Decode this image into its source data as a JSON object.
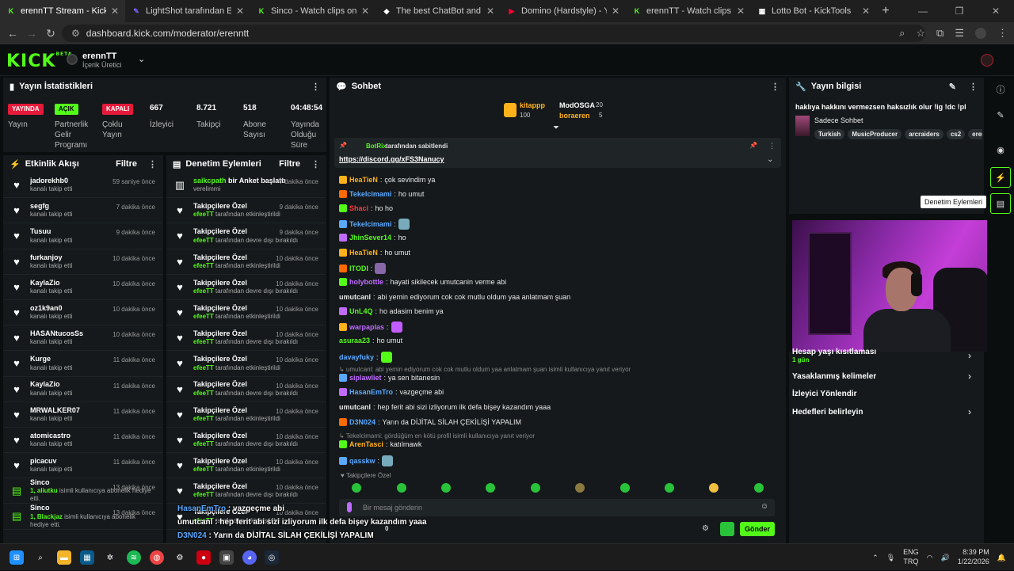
{
  "browser": {
    "tabs": [
      {
        "title": "erennTT Stream - Kick Dashboar",
        "color": "#53fc18",
        "glyph": "K"
      },
      {
        "title": "LightShot tarafından Ekran Gör",
        "color": "#7b5cff",
        "glyph": "✎"
      },
      {
        "title": "Sinco - Watch clips on Kick",
        "color": "#53fc18",
        "glyph": "K"
      },
      {
        "title": "The best ChatBot and Widgets",
        "color": "#ffffff",
        "glyph": "◆"
      },
      {
        "title": "Domino (Hardstyle) - YouTube",
        "color": "#ff0033",
        "glyph": "▶"
      },
      {
        "title": "erennTT - Watch clips on Kick",
        "color": "#53fc18",
        "glyph": "K"
      },
      {
        "title": "Lotto Bot - KickTools",
        "color": "#ffffff",
        "glyph": "▦"
      }
    ],
    "url": "dashboard.kick.com/moderator/erenntt"
  },
  "header": {
    "logo": "KICK",
    "logo_sup": "BETA",
    "channel_name": "erennTT",
    "channel_role": "İçerik Üretici"
  },
  "stats": {
    "title": "Yayın İstatistikleri",
    "items": [
      {
        "pill": "YAYINDA",
        "label": "Yayın"
      },
      {
        "pill": "AÇIK",
        "label": "Partnerlik Gelir Programı"
      },
      {
        "pill": "KAPALI",
        "label": "Çoklu Yayın"
      },
      {
        "value": "667",
        "label": "İzleyici"
      },
      {
        "value": "8.721",
        "label": "Takipçi"
      },
      {
        "value": "518",
        "label": "Abone Sayısı"
      },
      {
        "value": "04:48:54",
        "label": "Yayında Olduğu Süre"
      }
    ]
  },
  "activity": {
    "title": "Etkinlik Akışı",
    "filter": "Filtre",
    "rows": [
      {
        "name": "jadorekhb0",
        "sub": "kanalı takip etti",
        "time": "59 saniye önce"
      },
      {
        "name": "segfg",
        "sub": "kanalı takip etti",
        "time": "7 dakika önce"
      },
      {
        "name": "Tusuu",
        "sub": "kanalı takip etti",
        "time": "9 dakika önce"
      },
      {
        "name": "furkanjoy",
        "sub": "kanalı takip etti",
        "time": "10 dakika önce"
      },
      {
        "name": "KaylaZio",
        "sub": "kanalı takip etti",
        "time": "10 dakika önce"
      },
      {
        "name": "oz1k9an0",
        "sub": "kanalı takip etti",
        "time": "10 dakika önce"
      },
      {
        "name": "HASANtucosSs",
        "sub": "kanalı takip etti",
        "time": "10 dakika önce"
      },
      {
        "name": "Kurge",
        "sub": "kanalı takip etti",
        "time": "11 dakika önce"
      },
      {
        "name": "KaylaZio",
        "sub": "kanalı takip etti",
        "time": "11 dakika önce"
      },
      {
        "name": "MRWALKER07",
        "sub": "kanalı takip etti",
        "time": "11 dakika önce"
      },
      {
        "name": "atomicastro",
        "sub": "kanalı takip etti",
        "time": "11 dakika önce"
      },
      {
        "name": "picacuv",
        "sub": "kanalı takip etti",
        "time": "11 dakika önce"
      },
      {
        "name": "Sinco",
        "sub_bold": "1, aliutku",
        "sub": "isimli kullanıcıya abonelik hediye etti.",
        "time": "13 dakika önce"
      },
      {
        "name": "Sinco",
        "sub_bold": "1, Blackjaz",
        "sub": "isimli kullanıcıya abonelik hediye etti.",
        "time": "13 dakika önce"
      }
    ]
  },
  "modlog": {
    "title": "Denetim Eylemleri",
    "filter": "Filtre",
    "rows": [
      {
        "name_green": "saikcpath",
        "name": "bir Anket başlattı",
        "sub": "verelimmi",
        "time": "7 dakika önce"
      },
      {
        "name": "Takipçilere Özel",
        "sub_bold": "efeeTT",
        "sub": "tarafından etkinleştirildi",
        "time": "9 dakika önce"
      },
      {
        "name": "Takipçilere Özel",
        "sub_bold": "efeeTT",
        "sub": "tarafından devre dışı bırakıldı",
        "time": "9 dakika önce"
      },
      {
        "name": "Takipçilere Özel",
        "sub_bold": "efeeTT",
        "sub": "tarafından etkinleştirildi",
        "time": "10 dakika önce"
      },
      {
        "name": "Takipçilere Özel",
        "sub_bold": "efeeTT",
        "sub": "tarafından devre dışı bırakıldı",
        "time": "10 dakika önce"
      },
      {
        "name": "Takipçilere Özel",
        "sub_bold": "efeeTT",
        "sub": "tarafından etkinleştirildi",
        "time": "10 dakika önce"
      },
      {
        "name": "Takipçilere Özel",
        "sub_bold": "efeeTT",
        "sub": "tarafından devre dışı bırakıldı",
        "time": "10 dakika önce"
      },
      {
        "name": "Takipçilere Özel",
        "sub_bold": "efeeTT",
        "sub": "tarafından etkinleştirildi",
        "time": "10 dakika önce"
      },
      {
        "name": "Takipçilere Özel",
        "sub_bold": "efeeTT",
        "sub": "tarafından devre dışı bırakıldı",
        "time": "10 dakika önce"
      },
      {
        "name": "Takipçilere Özel",
        "sub_bold": "efeeTT",
        "sub": "tarafından etkinleştirildi",
        "time": "10 dakika önce"
      },
      {
        "name": "Takipçilere Özel",
        "sub_bold": "efeeTT",
        "sub": "tarafından devre dışı bırakıldı",
        "time": "10 dakika önce"
      },
      {
        "name": "Takipçilere Özel",
        "sub_bold": "efeeTT",
        "sub": "tarafından etkinleştirildi",
        "time": "10 dakika önce"
      },
      {
        "name": "Takipçilere Özel",
        "sub_bold": "efeeTT",
        "sub": "tarafından devre dışı bırakıldı",
        "time": "10 dakika önce"
      },
      {
        "name": "Takipçilere Özel",
        "sub_bold": "efeeTT",
        "sub": "tarafından etkinleştirildi",
        "time": "10 dakika önce"
      }
    ]
  },
  "chat": {
    "title": "Sohbet",
    "top_users": [
      {
        "name": "kitappp",
        "count": "100",
        "color": "#ffb21b"
      },
      {
        "name": "ModOSGA",
        "count": "20",
        "color": "#ffffff"
      },
      {
        "name": "boraeren",
        "count": "5",
        "color": "#ffb21b"
      }
    ],
    "pinned": {
      "by_user": "BotRix",
      "by_text": "tarafından sabitlendi",
      "link": "https://discord.gg/xFS3Nanucy"
    },
    "messages": [
      {
        "user": "HeaTieN",
        "color": "#ffb21b",
        "text": "çok sevindim ya"
      },
      {
        "user": "Tekelcimami",
        "color": "#5aa9ff",
        "text": "ho umut"
      },
      {
        "user": "Shaci",
        "color": "#ff3a3a",
        "text": "ho ho"
      },
      {
        "user": "Tekelcimami",
        "color": "#5aa9ff",
        "text": ""
      },
      {
        "user": "JhinSever14",
        "color": "#53fc18",
        "text": "ho"
      },
      {
        "user": "HeaTieN",
        "color": "#ffb21b",
        "text": "ho umut"
      },
      {
        "user": "ITODI",
        "color": "#53fc18",
        "text": ""
      },
      {
        "user": "holybottle",
        "color": "#c06bff",
        "text": "hayati sikilecek umutcanin verme abi"
      },
      {
        "user": "umutcanl",
        "color": "#e8e8e8",
        "text": "abi yemin ediyorum cok cok mutlu oldum yaa anlatmam şuan"
      },
      {
        "user": "UnL4Q",
        "color": "#53fc18",
        "text": "ho adasim benim ya"
      },
      {
        "user": "warpaplas",
        "color": "#c06bff",
        "text": ""
      },
      {
        "user": "asuraa23",
        "color": "#53fc18",
        "text": "ho umut"
      },
      {
        "user": "davayfuky",
        "color": "#5aa9ff",
        "text": ""
      },
      {
        "user": "siplawliet",
        "color": "#c06bff",
        "text": "ya sen bitanesin"
      },
      {
        "user": "HasanEmTro",
        "color": "#5aa9ff",
        "text": "vazgeçme abi"
      },
      {
        "user": "umutcanl",
        "color": "#e8e8e8",
        "text": "hep ferit abi sizi izliyorum ilk defa bişey kazandım yaaa"
      },
      {
        "user": "D3N024",
        "color": "#5aa9ff",
        "text": "Yarın da DİJİTAL SİLAH ÇEKİLİŞİ YAPALIM"
      },
      {
        "user": "ArenTasci",
        "color": "#ffb21b",
        "text": "katılmawk"
      },
      {
        "user": "qasskw",
        "color": "#5aa9ff",
        "text": ""
      }
    ],
    "replies": [
      "umutcanl: abi yemin ediyorum cok cok mutlu oldum yaa anlatmam şuan isimli kullanıcıya yanıt veriyor",
      "Tekelcimami: gördüğüm en kötü profil isimli kullanıcıya yanıt veriyor"
    ],
    "mode_note": "Takipçilere Özel",
    "input_placeholder": "Bir mesaj gönderin",
    "send_label": "Gönder"
  },
  "overlay": {
    "lines": [
      {
        "user": "HasanEmTro",
        "text": "vazgeçme abi"
      },
      {
        "user": "umutcanl",
        "text": "hep ferit abi sizi izliyorum ilk defa bişey kazandım yaaa"
      },
      {
        "user": "D3N024",
        "text": "Yarın da DİJİTAL SİLAH ÇEKİLİŞİ YAPALIM"
      },
      {
        "user": "ArenTasci",
        "text": "katılmawk"
      },
      {
        "user": "qasskw",
        "text": ""
      }
    ],
    "counter": "0"
  },
  "stream_info": {
    "title": "Yayın bilgisi",
    "stream_title": "haklıya hakkını vermezsen haksızlık olur !ig !dc !pl",
    "category": "Sadece Sohbet",
    "tags": [
      "Turkish",
      "MusicProducer",
      "arcraiders",
      "cs2",
      "eren"
    ]
  },
  "tooltip": "Denetim Eylemleri",
  "settings": {
    "rows": [
      {
        "label": "Hesap yaşı kısıtlaması",
        "sub": "1 gün"
      },
      {
        "label": "Yasaklanmış kelimeler"
      },
      {
        "label": "İzleyici Yönlendir"
      },
      {
        "label": "Hedefleri belirleyin"
      }
    ]
  },
  "taskbar": {
    "lang": "ENG",
    "lang2": "TRQ",
    "time": "8:39 PM",
    "date": "1/22/2026"
  }
}
